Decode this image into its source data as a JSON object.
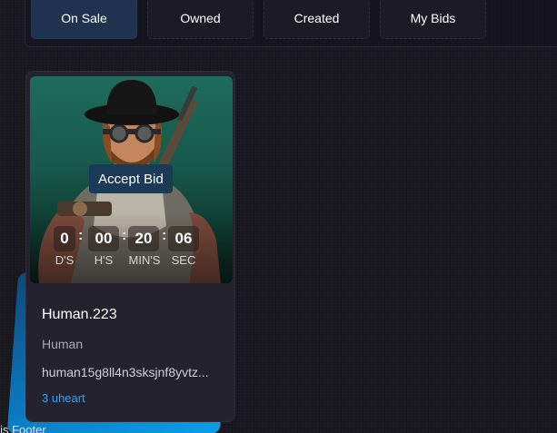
{
  "tabs": [
    {
      "label": "On Sale",
      "active": true
    },
    {
      "label": "Owned",
      "active": false
    },
    {
      "label": "Created",
      "active": false
    },
    {
      "label": "My Bids",
      "active": false
    }
  ],
  "card": {
    "accept_bid_label": "Accept Bid",
    "countdown": {
      "days": "0",
      "hours": "00",
      "minutes": "20",
      "seconds": "06",
      "days_label": "D'S",
      "hours_label": "H'S",
      "minutes_label": "MIN'S",
      "seconds_label": "SEC",
      "separator": ":"
    },
    "name": "Human.223",
    "type": "Human",
    "address": "human15g8ll4n3sksjnf8yvtz...",
    "price": "3 uheart"
  },
  "footer": {
    "text": "s is Footer"
  },
  "colors": {
    "background": "#19181f",
    "active_tab": "#1f3350",
    "card": "#23222e",
    "accent": "#3aa0ef",
    "glow": "#0b79c2"
  }
}
